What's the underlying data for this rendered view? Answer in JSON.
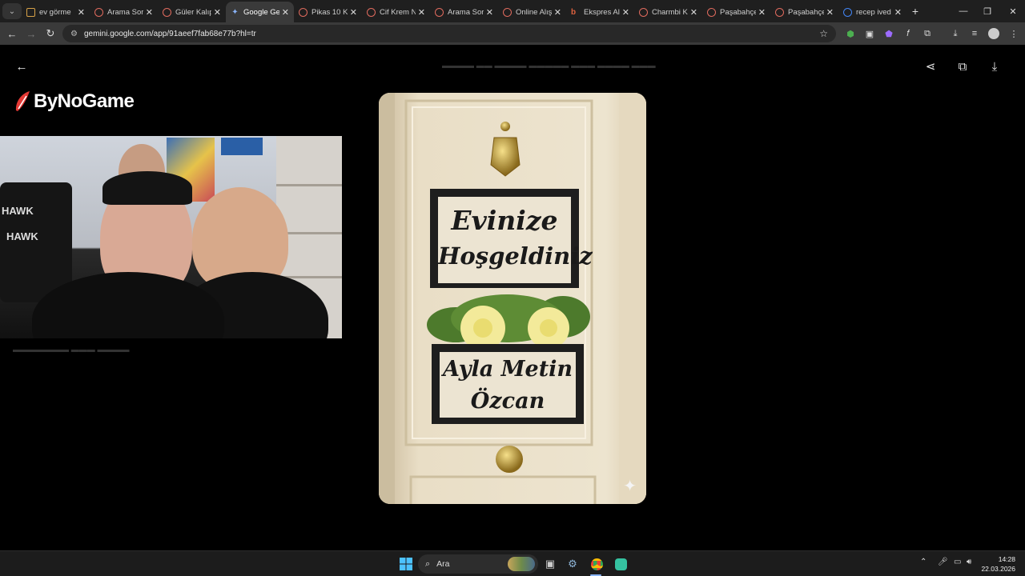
{
  "browser": {
    "tabs": [
      {
        "title": "ev görme",
        "active": false,
        "icon": "mail-icon"
      },
      {
        "title": "Arama Sor",
        "active": false,
        "icon": "red-circle-icon"
      },
      {
        "title": "Güler Kalıp",
        "active": false,
        "icon": "red-circle-icon"
      },
      {
        "title": "Google Ge",
        "active": true,
        "icon": "gemini-icon"
      },
      {
        "title": "Pikas 10 K",
        "active": false,
        "icon": "red-circle-icon"
      },
      {
        "title": "Cif Krem N",
        "active": false,
        "icon": "red-circle-icon"
      },
      {
        "title": "Arama Sor",
        "active": false,
        "icon": "red-circle-icon"
      },
      {
        "title": "Online Alış",
        "active": false,
        "icon": "red-circle-icon"
      },
      {
        "title": "Ekspres Al",
        "active": false,
        "icon": "b-icon"
      },
      {
        "title": "Charmbi K",
        "active": false,
        "icon": "red-circle-icon"
      },
      {
        "title": "Paşabahçe",
        "active": false,
        "icon": "red-circle-icon"
      },
      {
        "title": "Paşabahçe",
        "active": false,
        "icon": "red-circle-icon"
      },
      {
        "title": "recep ived",
        "active": false,
        "icon": "google-icon"
      }
    ],
    "url": "gemini.google.com/app/91aeef7fab68e77b?hl=tr"
  },
  "viewer": {
    "brand_name": "ByNoGame",
    "image_text": {
      "line1": "Evinize",
      "line2": "Hoşgeldiniz",
      "name_line1": "Ayla Metin",
      "name_line2": "Özcan"
    }
  },
  "taskbar": {
    "search_label": "Ara",
    "time": "14:28",
    "date": "22.03.2026"
  },
  "colors": {
    "tab_bar": "#1f1f1f",
    "toolbar": "#3a3a3a",
    "viewer_bg": "#000000",
    "door": "#e8dcc3",
    "brand_red": "#e53935"
  }
}
